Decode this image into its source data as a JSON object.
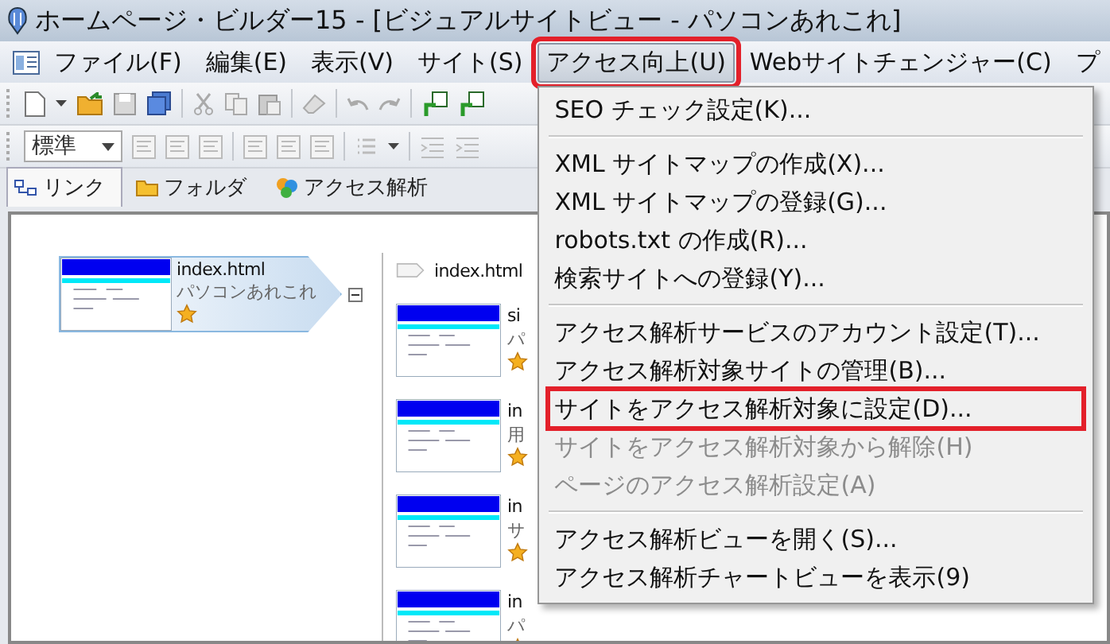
{
  "window": {
    "title": "ホームページ・ビルダー15 - [ビジュアルサイトビュー - パソコンあれこれ]"
  },
  "menu_bar": [
    {
      "label": "ファイル(F)",
      "open": false,
      "highlighted": false
    },
    {
      "label": "編集(E)",
      "open": false,
      "highlighted": false
    },
    {
      "label": "表示(V)",
      "open": false,
      "highlighted": false
    },
    {
      "label": "サイト(S)",
      "open": false,
      "highlighted": false
    },
    {
      "label": "アクセス向上(U)",
      "open": true,
      "highlighted": true
    },
    {
      "label": "Webサイトチェンジャー(C)",
      "open": false,
      "highlighted": false
    },
    {
      "label": "プ",
      "open": false,
      "highlighted": false
    }
  ],
  "style_dropdown": {
    "value": "標準"
  },
  "tabs": [
    {
      "label": "リンク",
      "selected": true
    },
    {
      "label": "フォルダ",
      "selected": false
    },
    {
      "label": "アクセス解析",
      "selected": false
    }
  ],
  "site_tree": {
    "root": {
      "file": "index.html",
      "title": "パソコンあれこれ",
      "expanded": true
    },
    "header": "index.html",
    "children": [
      {
        "file": "si",
        "title": "パ"
      },
      {
        "file": "in",
        "title": "用"
      },
      {
        "file": "in",
        "title": "サ"
      },
      {
        "file": "in",
        "title": "パ"
      }
    ]
  },
  "dropdown_menu": [
    {
      "kind": "item",
      "label": "SEO チェック設定(K)...",
      "disabled": false,
      "highlighted": false
    },
    {
      "kind": "separator"
    },
    {
      "kind": "item",
      "label": "XML サイトマップの作成(X)...",
      "disabled": false,
      "highlighted": false
    },
    {
      "kind": "item",
      "label": "XML サイトマップの登録(G)...",
      "disabled": false,
      "highlighted": false
    },
    {
      "kind": "item",
      "label": "robots.txt の作成(R)...",
      "disabled": false,
      "highlighted": false
    },
    {
      "kind": "item",
      "label": "検索サイトへの登録(Y)...",
      "disabled": false,
      "highlighted": false
    },
    {
      "kind": "separator"
    },
    {
      "kind": "item",
      "label": "アクセス解析サービスのアカウント設定(T)...",
      "disabled": false,
      "highlighted": false
    },
    {
      "kind": "item",
      "label": "アクセス解析対象サイトの管理(B)...",
      "disabled": false,
      "highlighted": false
    },
    {
      "kind": "item",
      "label": "サイトをアクセス解析対象に設定(D)...",
      "disabled": false,
      "highlighted": true
    },
    {
      "kind": "item",
      "label": "サイトをアクセス解析対象から解除(H)",
      "disabled": true,
      "highlighted": false
    },
    {
      "kind": "item",
      "label": "ページのアクセス解析設定(A)",
      "disabled": true,
      "highlighted": false
    },
    {
      "kind": "separator"
    },
    {
      "kind": "item",
      "label": "アクセス解析ビューを開く(S)...",
      "disabled": false,
      "highlighted": false
    },
    {
      "kind": "item",
      "label": "アクセス解析チャートビューを表示(9)",
      "disabled": false,
      "highlighted": false
    }
  ]
}
